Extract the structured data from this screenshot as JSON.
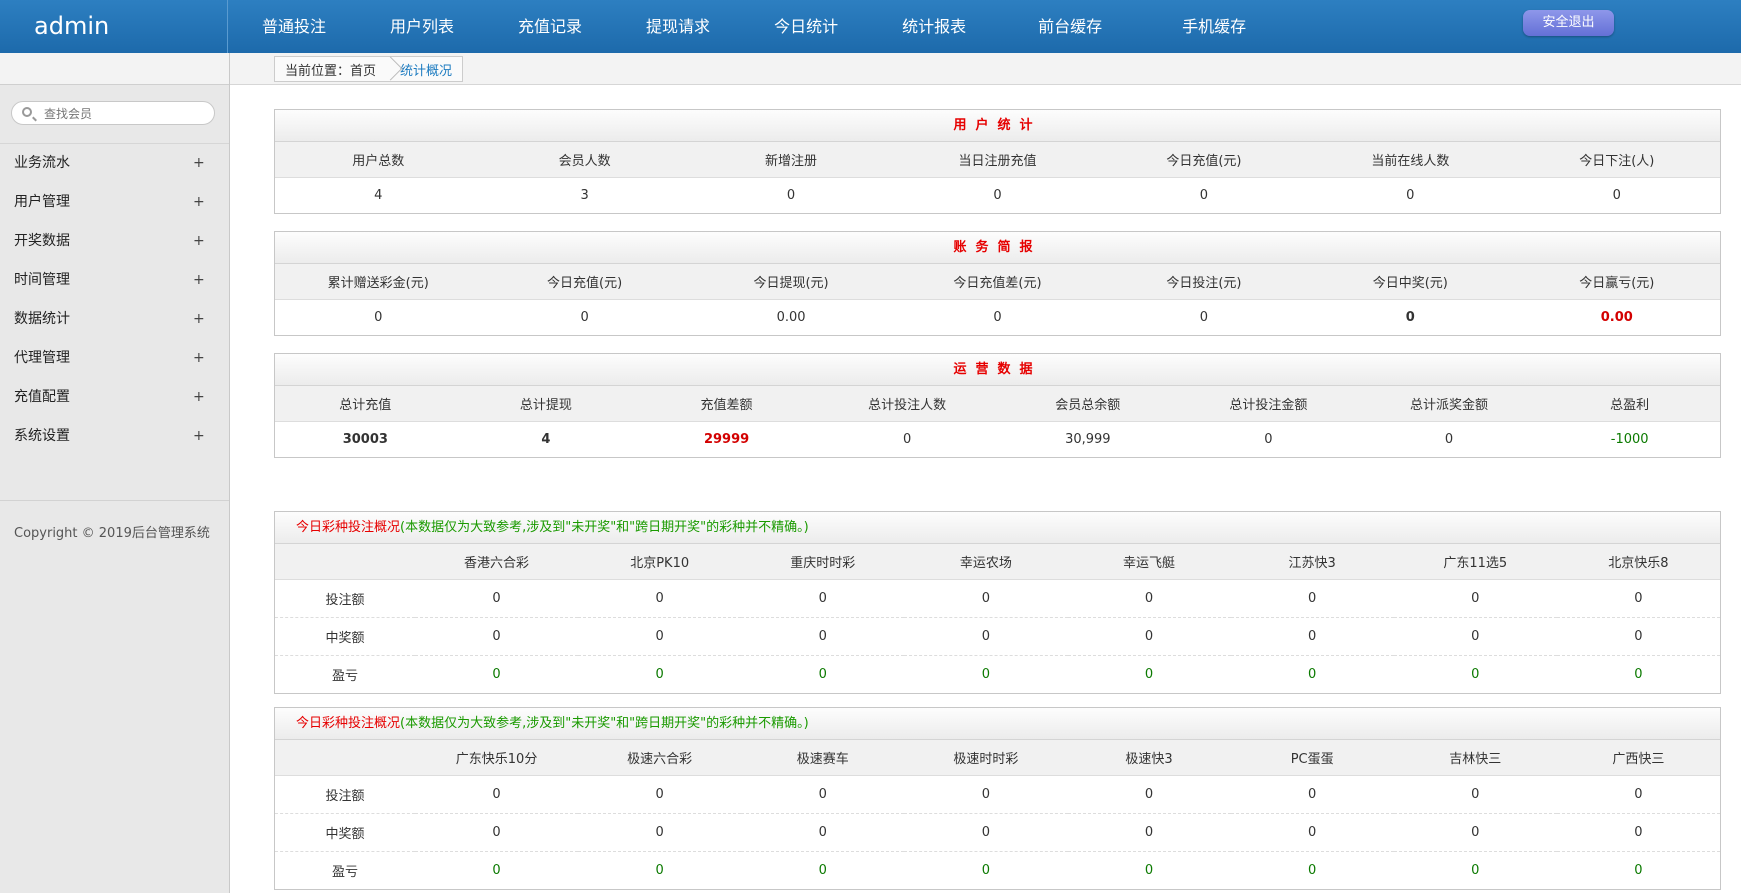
{
  "header": {
    "logo": "admin",
    "nav": [
      "普通投注",
      "用户列表",
      "充值记录",
      "提现请求",
      "今日统计",
      "统计报表",
      "前台缓存",
      "手机缓存"
    ],
    "logout": "安全退出"
  },
  "breadcrumb": {
    "location": "当前位置：首页",
    "current": "统计概况"
  },
  "sidebar": {
    "search_placeholder": "查找会员",
    "items": [
      "业务流水",
      "用户管理",
      "开奖数据",
      "时间管理",
      "数据统计",
      "代理管理",
      "充值配置",
      "系统设置"
    ],
    "plus": "+",
    "copyright": "Copyright © 2019后台管理系统"
  },
  "user_stats": {
    "title": "用户统计",
    "headers": [
      "用户总数",
      "会员人数",
      "新增注册",
      "当日注册充值",
      "今日充值(元)",
      "当前在线人数",
      "今日下注(人)"
    ],
    "values": [
      "4",
      "3",
      "0",
      "0",
      "0",
      "0",
      "0"
    ]
  },
  "finance": {
    "title": "账务简报",
    "headers": [
      "累计赠送彩金(元)",
      "今日充值(元)",
      "今日提现(元)",
      "今日充值差(元)",
      "今日投注(元)",
      "今日中奖(元)",
      "今日赢亏(元)"
    ],
    "values": [
      "0",
      "0",
      "0.00",
      "0",
      "0",
      "0",
      "0.00"
    ]
  },
  "operations": {
    "title": "运营数据",
    "headers": [
      "总计充值",
      "总计提现",
      "充值差额",
      "总计投注人数",
      "会员总余额",
      "总计投注金额",
      "总计派奖金额",
      "总盈利"
    ],
    "values": [
      "30003",
      "4",
      "29999",
      "0",
      "30,999",
      "0",
      "0",
      "-1000"
    ]
  },
  "lottery1": {
    "title": "今日彩种投注概况",
    "note": "(本数据仅为大致参考,涉及到\"未开奖\"和\"跨日期开奖\"的彩种并不精确。)",
    "games": [
      "香港六合彩",
      "北京PK10",
      "重庆时时彩",
      "幸运农场",
      "幸运飞艇",
      "江苏快3",
      "广东11选5",
      "北京快乐8"
    ],
    "rows": [
      {
        "label": "投注额",
        "values": [
          "0",
          "0",
          "0",
          "0",
          "0",
          "0",
          "0",
          "0"
        ]
      },
      {
        "label": "中奖额",
        "values": [
          "0",
          "0",
          "0",
          "0",
          "0",
          "0",
          "0",
          "0"
        ]
      },
      {
        "label": "盈亏",
        "values": [
          "0",
          "0",
          "0",
          "0",
          "0",
          "0",
          "0",
          "0"
        ]
      }
    ]
  },
  "lottery2": {
    "title": "今日彩种投注概况",
    "note": "(本数据仅为大致参考,涉及到\"未开奖\"和\"跨日期开奖\"的彩种并不精确。)",
    "games": [
      "广东快乐10分",
      "极速六合彩",
      "极速赛车",
      "极速时时彩",
      "极速快3",
      "PC蛋蛋",
      "吉林快三",
      "广西快三"
    ],
    "rows": [
      {
        "label": "投注额",
        "values": [
          "0",
          "0",
          "0",
          "0",
          "0",
          "0",
          "0",
          "0"
        ]
      },
      {
        "label": "中奖额",
        "values": [
          "0",
          "0",
          "0",
          "0",
          "0",
          "0",
          "0",
          "0"
        ]
      },
      {
        "label": "盈亏",
        "values": [
          "0",
          "0",
          "0",
          "0",
          "0",
          "0",
          "0",
          "0"
        ]
      }
    ]
  },
  "colors": {
    "accent": "#2171b5",
    "title_red": "#e60000",
    "note_green": "#1a9a00",
    "value_red": "#d30000",
    "profit_green": "#0b7a00"
  }
}
